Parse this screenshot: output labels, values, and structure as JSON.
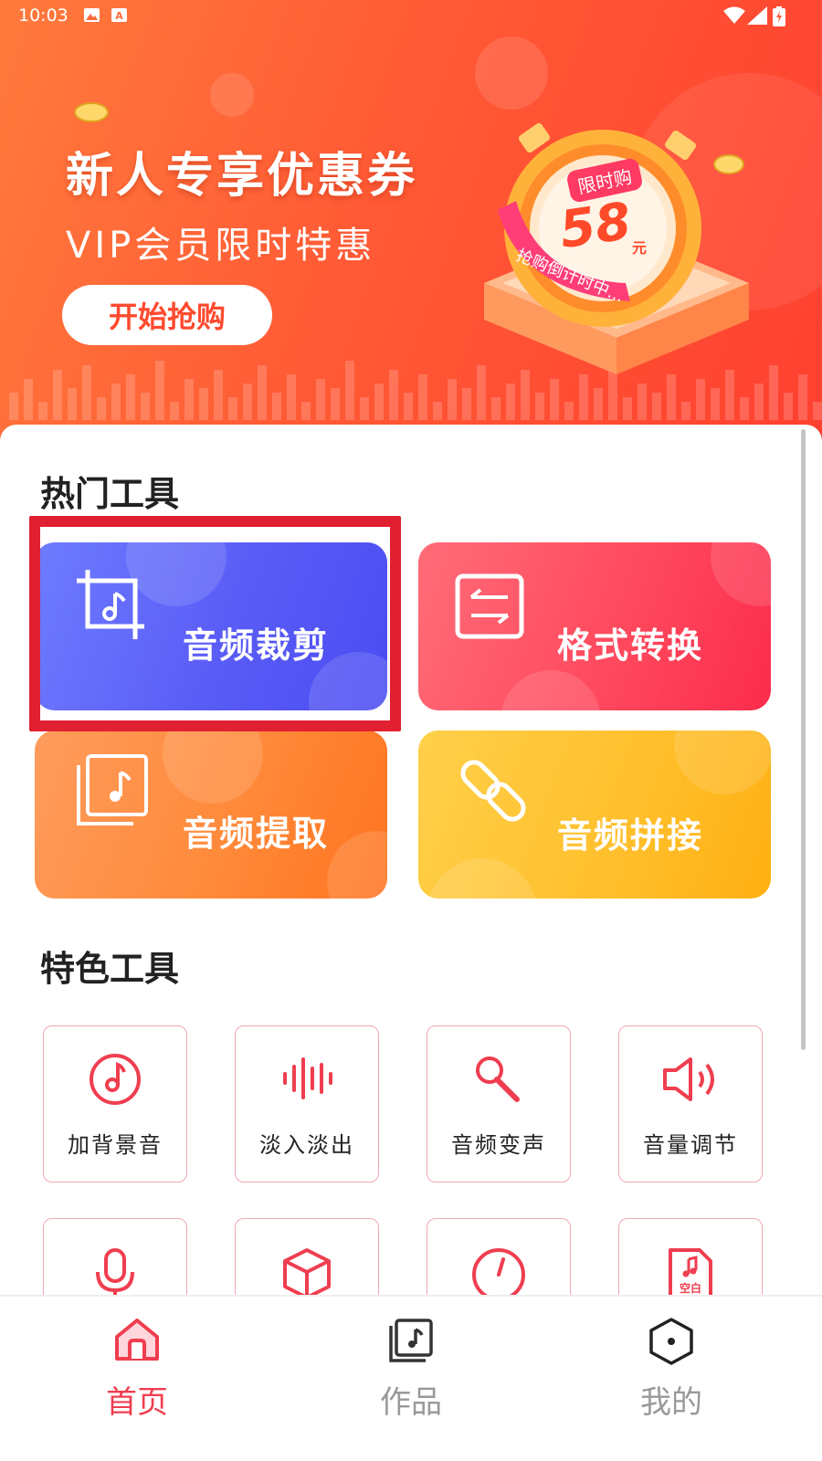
{
  "status_bar": {
    "time": "10:03"
  },
  "banner": {
    "title": "新人专享优惠券",
    "subtitle": "VIP会员限时特惠",
    "button_label": "开始抢购",
    "badge_label": "限时购",
    "price": "58",
    "price_unit": "元",
    "countdown_text": "抢购倒计时中..."
  },
  "hot_tools": {
    "title": "热门工具",
    "items": [
      {
        "label": "音频裁剪",
        "icon": "crop-music-icon"
      },
      {
        "label": "格式转换",
        "icon": "convert-arrows-icon"
      },
      {
        "label": "音频提取",
        "icon": "stacked-music-icon"
      },
      {
        "label": "音频拼接",
        "icon": "link-icon"
      }
    ]
  },
  "feature_tools": {
    "title": "特色工具",
    "items": [
      {
        "label": "加背景音",
        "icon": "music-disc-icon"
      },
      {
        "label": "淡入淡出",
        "icon": "waveform-icon"
      },
      {
        "label": "音频变声",
        "icon": "microphone-karaoke-icon"
      },
      {
        "label": "音量调节",
        "icon": "speaker-icon"
      },
      {
        "label": "",
        "icon": "microphone-icon"
      },
      {
        "label": "",
        "icon": "cube-icon"
      },
      {
        "label": "",
        "icon": "gauge-icon"
      },
      {
        "label": "",
        "icon": "blank-music-file-icon",
        "icon_text": "空白"
      }
    ]
  },
  "bottom_nav": {
    "items": [
      {
        "label": "首页",
        "icon": "home-icon",
        "active": true
      },
      {
        "label": "作品",
        "icon": "works-icon",
        "active": false
      },
      {
        "label": "我的",
        "icon": "profile-hexagon-icon",
        "active": false
      }
    ]
  },
  "colors": {
    "accent": "#ef3e4f",
    "banner_orange": "#ff5a35",
    "card_blue": "#5b5ff8",
    "card_red": "#ff4a5e",
    "card_orange": "#ff8a3a",
    "card_yellow": "#ffc02e",
    "highlight_box": "#e02030"
  }
}
